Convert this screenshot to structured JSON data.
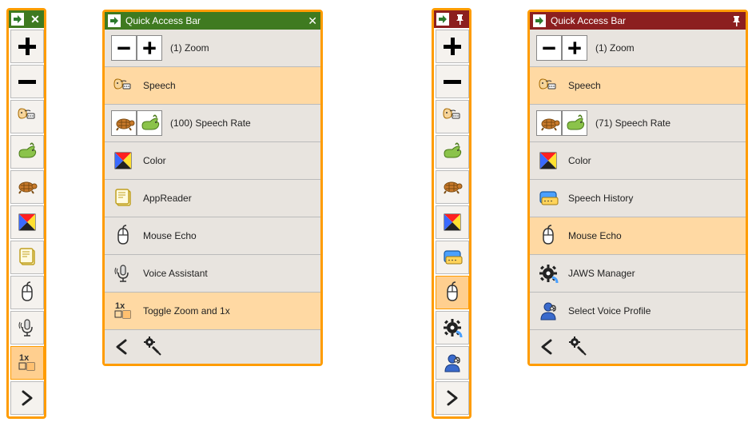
{
  "left": {
    "header_color": "green",
    "collapsed": {
      "items": [
        "zoom-in",
        "zoom-out",
        "speech",
        "speech-rate-up",
        "speech-rate-down",
        "color",
        "app-reader",
        "mouse-echo",
        "voice-assistant",
        "toggle-zoom-1x",
        "expand"
      ],
      "selected": "toggle-zoom-1x"
    },
    "panel": {
      "title": "Quick Access Bar",
      "rows": [
        {
          "id": "zoom",
          "icons": [
            "minus",
            "plus"
          ],
          "label": "(1) Zoom"
        },
        {
          "id": "speech",
          "icons": [
            "speech"
          ],
          "label": "Speech",
          "selected": true
        },
        {
          "id": "speech-rate",
          "icons": [
            "turtle",
            "rabbit"
          ],
          "label": "(100) Speech Rate"
        },
        {
          "id": "color",
          "icons": [
            "color"
          ],
          "label": "Color"
        },
        {
          "id": "app-reader",
          "icons": [
            "app-reader"
          ],
          "label": "AppReader"
        },
        {
          "id": "mouse-echo",
          "icons": [
            "mouse"
          ],
          "label": "Mouse Echo"
        },
        {
          "id": "voice-assistant",
          "icons": [
            "mic"
          ],
          "label": "Voice Assistant"
        },
        {
          "id": "toggle-zoom-1x",
          "icons": [
            "toggle1x"
          ],
          "label": "Toggle Zoom and 1x",
          "selected": true
        }
      ]
    }
  },
  "right": {
    "header_color": "darkred",
    "collapsed": {
      "items": [
        "zoom-in",
        "zoom-out",
        "speech",
        "speech-rate-up",
        "speech-rate-down",
        "color",
        "speech-history",
        "mouse-echo",
        "jaws-manager",
        "voice-profile",
        "expand"
      ],
      "selected": "mouse-echo"
    },
    "panel": {
      "title": "Quick Access Bar",
      "rows": [
        {
          "id": "zoom",
          "icons": [
            "minus",
            "plus"
          ],
          "label": "(1) Zoom"
        },
        {
          "id": "speech",
          "icons": [
            "speech"
          ],
          "label": "Speech",
          "selected": true
        },
        {
          "id": "speech-rate",
          "icons": [
            "turtle",
            "rabbit"
          ],
          "label": "(71) Speech Rate"
        },
        {
          "id": "color",
          "icons": [
            "color"
          ],
          "label": "Color"
        },
        {
          "id": "speech-history",
          "icons": [
            "speech-history"
          ],
          "label": "Speech History"
        },
        {
          "id": "mouse-echo",
          "icons": [
            "mouse"
          ],
          "label": "Mouse Echo",
          "selected": true
        },
        {
          "id": "jaws-manager",
          "icons": [
            "gear"
          ],
          "label": "JAWS Manager"
        },
        {
          "id": "voice-profile",
          "icons": [
            "profile"
          ],
          "label": "Select Voice Profile"
        }
      ]
    }
  }
}
